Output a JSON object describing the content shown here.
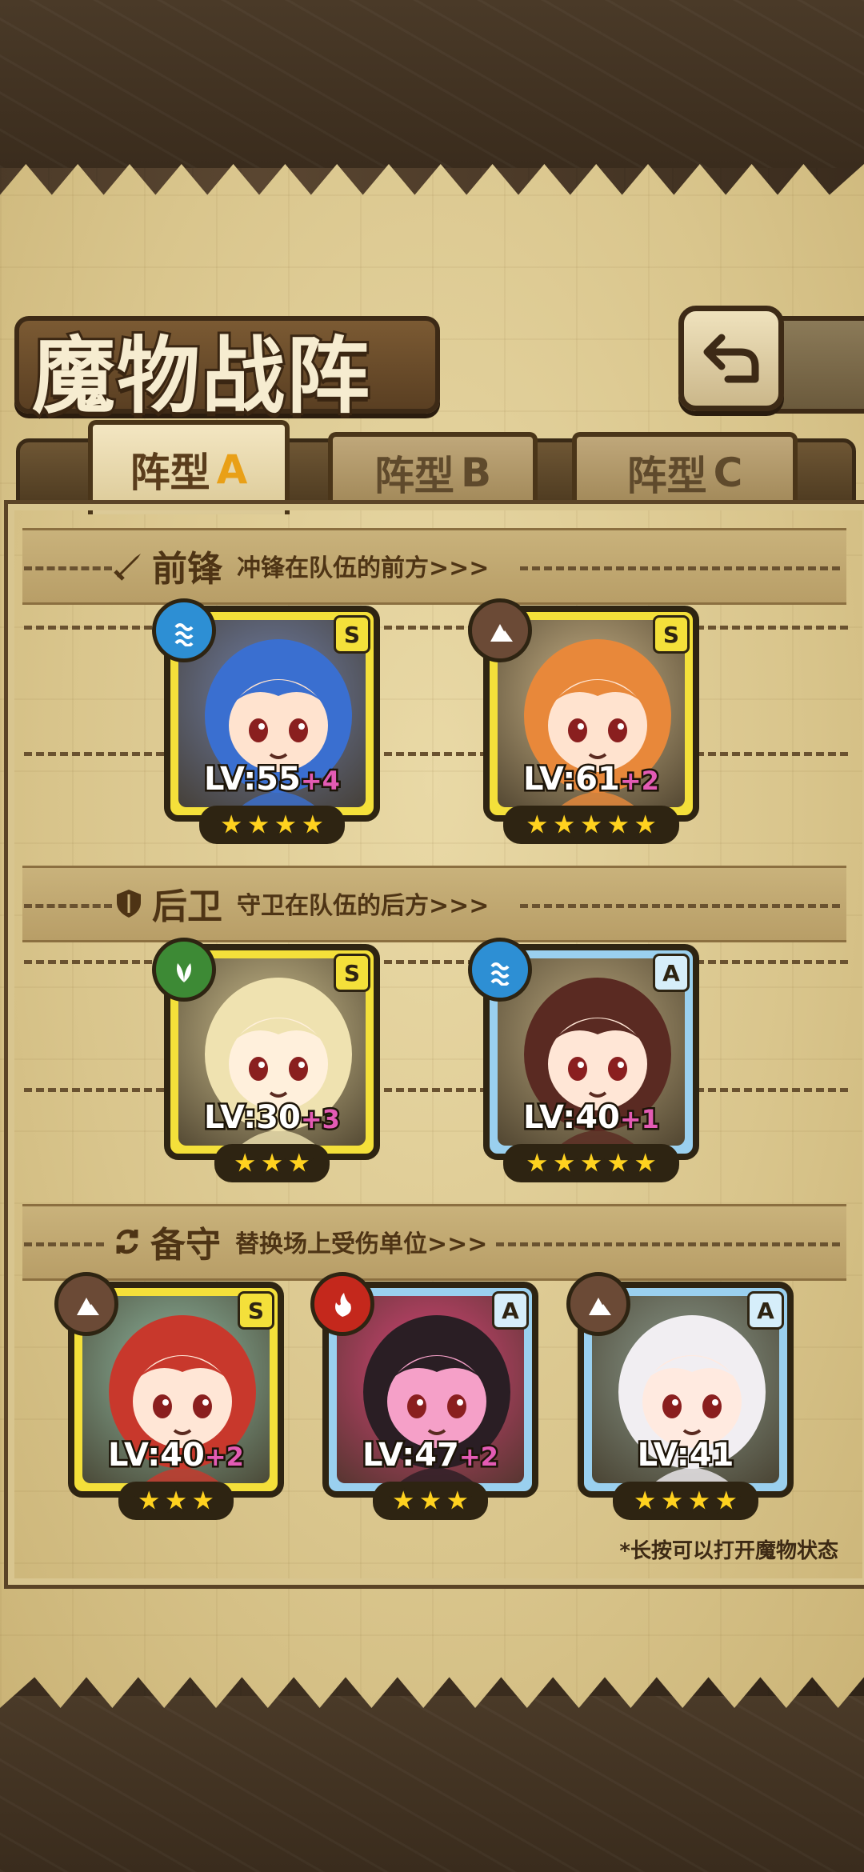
{
  "title": "魔物战阵",
  "back_icon": "back-arrow-icon",
  "tabs": [
    {
      "label": "阵型",
      "suffix": "A",
      "active": true
    },
    {
      "label": "阵型",
      "suffix": "B",
      "active": false
    },
    {
      "label": "阵型",
      "suffix": "C",
      "active": false
    }
  ],
  "sections": {
    "vanguard": {
      "icon": "sword-icon",
      "name": "前锋",
      "desc": "冲锋在队伍的前方>>>"
    },
    "rear": {
      "icon": "shield-icon",
      "name": "后卫",
      "desc": "守卫在队伍的后方>>>"
    },
    "reserve": {
      "icon": "swap-icon",
      "name": "备守",
      "desc": "替换场上受伤单位>>>"
    }
  },
  "vanguard_cards": [
    {
      "rank": "S",
      "element": "water",
      "level": "LV:55",
      "plus": "+4",
      "stars": 4,
      "frame": "gold",
      "hair": "#3a6fd0",
      "skin": "#ffe3cf",
      "bg": "#6f7fa8"
    },
    {
      "rank": "S",
      "element": "earth",
      "level": "LV:61",
      "plus": "+2",
      "stars": 5,
      "frame": "gold",
      "hair": "#e8883a",
      "skin": "#ffe3cf",
      "bg": "#c9b387"
    }
  ],
  "rear_cards": [
    {
      "rank": "S",
      "element": "nature",
      "level": "LV:30",
      "plus": "+3",
      "stars": 3,
      "frame": "gold",
      "hair": "#efe2b0",
      "skin": "#fff0dc",
      "bg": "#cdbf8f"
    },
    {
      "rank": "A",
      "element": "water",
      "level": "LV:40",
      "plus": "+1",
      "stars": 5,
      "frame": "blue",
      "hair": "#5a2a22",
      "skin": "#ffe6d6",
      "bg": "#b7a57c"
    }
  ],
  "reserve_cards": [
    {
      "rank": "S",
      "element": "earth",
      "level": "LV:40",
      "plus": "+2",
      "stars": 3,
      "frame": "gold",
      "hair": "#c8382c",
      "skin": "#ffe6d6",
      "bg": "#8fb9a2"
    },
    {
      "rank": "A",
      "element": "fire",
      "level": "LV:47",
      "plus": "+2",
      "stars": 3,
      "frame": "blue",
      "hair": "#2a1e24",
      "skin": "#f5a0c8",
      "bg": "#d84478"
    },
    {
      "rank": "A",
      "element": "earth",
      "level": "LV:41",
      "plus": "",
      "stars": 4,
      "frame": "blue",
      "hair": "#f1eef2",
      "skin": "#ffeae0",
      "bg": "#8b9a8c"
    }
  ],
  "hint": "*长按可以打开魔物状态"
}
